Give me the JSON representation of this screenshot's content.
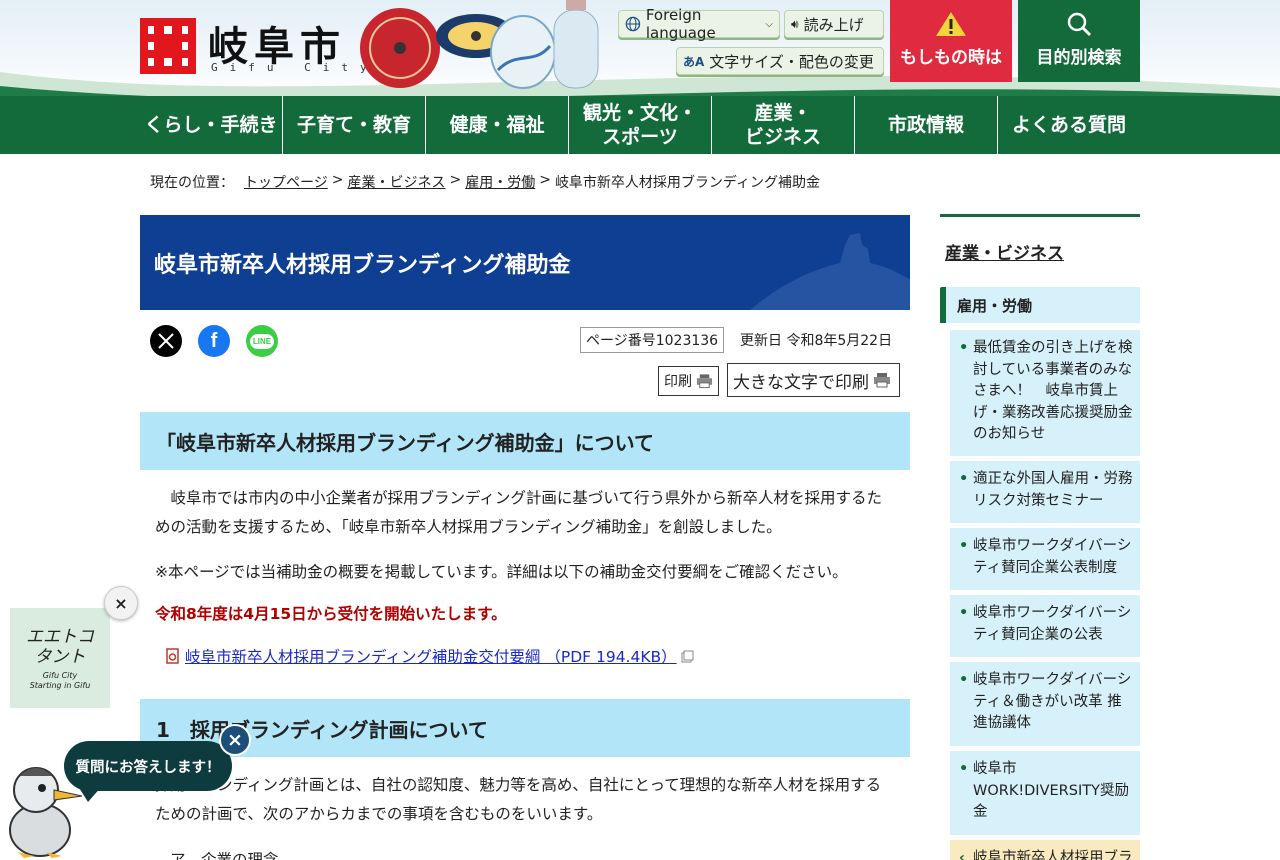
{
  "header": {
    "logo_text": "岐阜市",
    "logo_sub": "Gifu City",
    "lang_button": "Foreign language",
    "read_button": "読み上げ",
    "size_button_prefix": "あA",
    "size_button": "文字サイズ・配色の変更",
    "emergency_button": "もしもの時は",
    "search_button": "目的別検索"
  },
  "nav": {
    "items": [
      "くらし・手続き",
      "子育て・教育",
      "健康・福祉",
      "観光・文化・\nスポーツ",
      "産業・\nビジネス",
      "市政情報",
      "よくある質問"
    ]
  },
  "breadcrumb": {
    "prefix": "現在の位置：",
    "links": [
      "トップページ",
      "産業・ビジネス",
      "雇用・労働"
    ],
    "sep": ">",
    "current": "岐阜市新卒人材採用ブランディング補助金"
  },
  "main": {
    "title": "岐阜市新卒人材採用ブランディング補助金",
    "page_number": "ページ番号1023136",
    "updated": "更新日 令和8年5月22日",
    "print": "印刷",
    "print_large": "大きな文字で印刷",
    "h2_about": "「岐阜市新卒人材採用ブランディング補助金」について",
    "para_1": "岐阜市では市内の中小企業者が採用ブランディング計画に基づいて行う県外から新卒人材を採用するための活動を支援するため、「岐阜市新卒人材採用ブランディング補助金」を創設しました。",
    "para_2": "※本ページでは当補助金の概要を掲載しています。詳細は以下の補助金交付要綱をご確認ください。",
    "para_red": "令和8年度は4月15日から受付を開始いたします。",
    "pdf_link": "岐阜市新卒人材採用ブランディング補助金交付要綱 （PDF 194.4KB）",
    "h2_plan": "1　採用ブランディング計画について",
    "para_3": "採用ブランディング計画とは、自社の認知度、魅力等を高め、自社にとって理想的な新卒人材を採用するための計画で、次のアからカまでの事項を含むものをいいます。",
    "para_4": "ア　企業の理念"
  },
  "sidebar": {
    "title": "産業・ビジネス",
    "subtitle": "雇用・労働",
    "items": [
      "最低賃金の引き上げを検討している事業者のみなさまへ！　岐阜市賃上げ・業務改善応援奨励金のお知らせ",
      "適正な外国人雇用・労務リスク対策セミナー",
      "岐阜市ワークダイバーシティ賛同企業公表制度",
      "岐阜市ワークダイバーシティ賛同企業の公表",
      "岐阜市ワークダイバーシティ＆働きがい改革 推進協議体",
      "岐阜市WORK!DIVERSITY奨励金",
      "岐阜市新卒人材採用ブランディング補助金"
    ]
  },
  "float": {
    "banner_line1": "エエトコ",
    "banner_line2": "タント",
    "banner_line3": "Gifu City",
    "banner_line4": "Starting in Gifu",
    "close": "×",
    "chat_text": "質問にお答えします！",
    "chat_close": "×"
  },
  "colors": {
    "nav_green": "#136a3b",
    "title_blue": "#0f3f93",
    "heading_band": "#b3e5f9",
    "emergency_red": "#e02a3f",
    "notice_red": "#b00000",
    "link_blue": "#1a28c9"
  },
  "icons": {
    "lang": "globe-icon",
    "read": "speaker-icon",
    "emergency": "warning-icon",
    "search": "search-icon",
    "print": "printer-icon",
    "pdf": "pdf-icon",
    "external": "new-window-icon"
  }
}
